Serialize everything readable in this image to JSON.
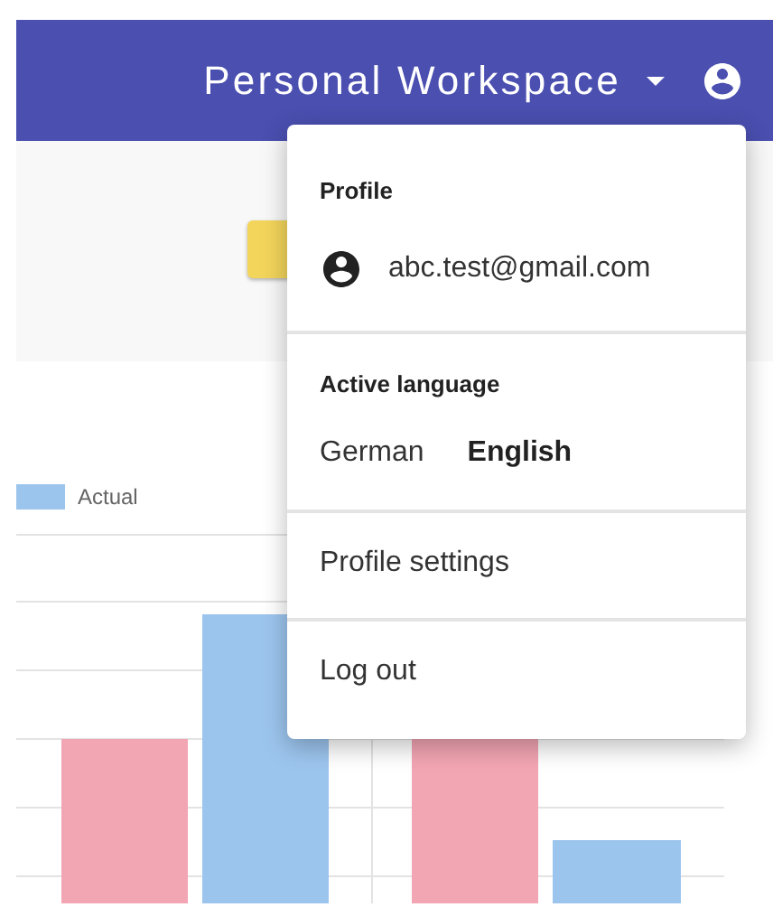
{
  "header": {
    "workspace": "Personal Workspace"
  },
  "chart": {
    "legend": [
      {
        "label": "Actual",
        "color": "#9cc5ee"
      }
    ]
  },
  "menu": {
    "profile_title": "Profile",
    "email": "abc.test@gmail.com",
    "language_title": "Active language",
    "languages": [
      {
        "label": "German",
        "selected": false
      },
      {
        "label": "English",
        "selected": true
      }
    ],
    "items": [
      "Profile settings",
      "Log out"
    ]
  }
}
